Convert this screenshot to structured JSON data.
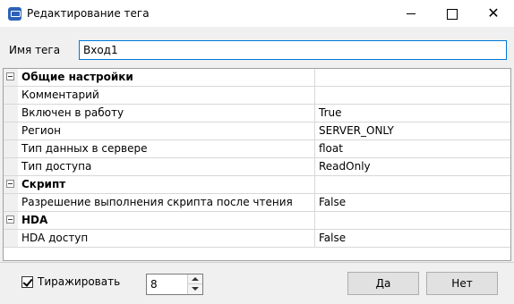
{
  "window": {
    "title": "Редактирование тега",
    "icon": "app-icon"
  },
  "tag_name": {
    "label": "Имя тега",
    "value": "Вход1"
  },
  "properties": [
    {
      "type": "section",
      "name": "Общие настройки",
      "value": ""
    },
    {
      "type": "item",
      "name": "Комментарий",
      "value": ""
    },
    {
      "type": "item",
      "name": "Включен в работу",
      "value": "True"
    },
    {
      "type": "item",
      "name": "Регион",
      "value": "SERVER_ONLY"
    },
    {
      "type": "item",
      "name": "Тип данных в сервере",
      "value": "float"
    },
    {
      "type": "item",
      "name": "Тип доступа",
      "value": "ReadOnly"
    },
    {
      "type": "section",
      "name": "Скрипт",
      "value": ""
    },
    {
      "type": "item",
      "name": "Разрешение выполнения скрипта после чтения",
      "value": "False"
    },
    {
      "type": "section",
      "name": "HDA",
      "value": ""
    },
    {
      "type": "item",
      "name": "HDA доступ",
      "value": "False"
    }
  ],
  "footer": {
    "replicate_label": "Тиражировать",
    "replicate_checked": true,
    "count": "8",
    "ok_label": "Да",
    "cancel_label": "Нет"
  }
}
